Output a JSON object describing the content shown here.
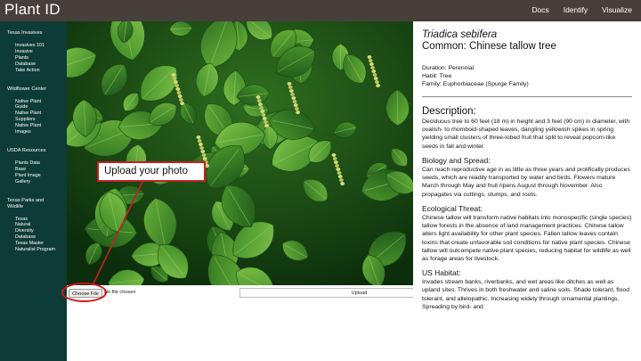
{
  "header": {
    "brand": "Plant ID",
    "nav": [
      {
        "label": "Docs"
      },
      {
        "label": "Identify"
      },
      {
        "label": "Visualize"
      }
    ]
  },
  "sidebar": {
    "sections": [
      {
        "heading": "Texas Invasives",
        "items": [
          "Invasives 101",
          "Invasive Plants Database",
          "Take Action"
        ]
      },
      {
        "heading": "Wildflower Center",
        "items": [
          "Native Plant Guide",
          "Native Plant Suppliers",
          "Native Plant Images"
        ]
      },
      {
        "heading": "USDA Resources",
        "items": [
          "Plants Data Base",
          "Plant Image Gallery"
        ]
      },
      {
        "heading": "Texas Parks and Wildlife",
        "items": [
          "Texas Natural Diversity Database",
          "Texas Master Naturalist Program"
        ]
      }
    ]
  },
  "upload": {
    "choose_file_label": "Choose File",
    "file_status": "No file chosen",
    "upload_label": "Upload",
    "callout_text": "Upload your photo",
    "callout_color": "#c62020"
  },
  "plant": {
    "scientific_name": "Triadica sebifera",
    "common_name": "Common: Chinese tallow tree",
    "duration": "Duration: Perennial",
    "habit": "Habit: Tree",
    "family": "Family: Euphorbiaceae (Spurge Family)",
    "description_heading": "Description:",
    "description": "Deciduous tree to 60 feet (18 m) in height and 3 feet (90 cm) in diameter, with ovalish- to rhomboid-shaped leaves, dangling yellowish spikes in spring yielding small clusters of three-lobed fruit that split to reveal popcorn-like seeds in fall and winter.",
    "biology_heading": "Biology and Spread:",
    "biology": "Can reach reproductive age in as little as three years and prolifically produces seeds, which are readily transported by water and birds. Flowers mature March through May and fruit ripens August through November. Also propagates via cuttings, stumps, and roots.",
    "threat_heading": "Ecological Threat:",
    "threat": "Chinese tallow will transform native habitats into monospecific (single species) tallow forests in the absence of land management practices. Chinese tallow alters light availability for other plant species. Fallen tallow leaves contain toxins that create unfavorable soil conditions for native plant species. Chinese tallow will outcompete native plant species, reducing habitat for wildlife as well as forage areas for livestock.",
    "habitat_heading": "US Habitat:",
    "habitat": "Invades stream banks, riverbanks, and wet areas like ditches as well as upland sites. Thrives in both freshwater and saline soils. Shade tolerant, flood tolerant, and allelopathic. Increasing widely through ornamental plantings. Spreading by bird- and"
  },
  "colors": {
    "topbar": "#473f3c",
    "sidebar": "#0d3b37",
    "leaf_dark": "#1f5e1a",
    "leaf_light": "#58a332"
  }
}
